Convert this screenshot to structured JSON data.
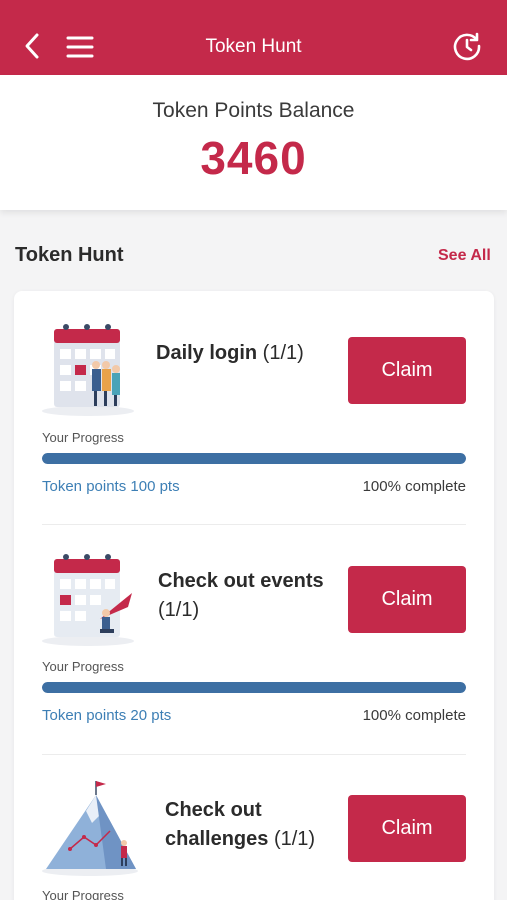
{
  "header": {
    "title": "Token Hunt",
    "back_icon": "chevron-left-icon",
    "menu_icon": "hamburger-menu-icon",
    "history_icon": "history-icon"
  },
  "balance": {
    "label": "Token Points Balance",
    "value": "3460"
  },
  "section": {
    "title": "Token Hunt",
    "see_all": "See All"
  },
  "tasks": [
    {
      "name": "Daily login",
      "count": " (1/1)",
      "claim_label": "Claim",
      "progress_label": "Your Progress",
      "progress": 1.0,
      "points": "Token points 100 pts",
      "percent": "100% complete"
    },
    {
      "name": "Check out events",
      "count": "(1/1)",
      "claim_label": "Claim",
      "progress_label": "Your Progress",
      "progress": 1.0,
      "points": "Token points 20 pts",
      "percent": "100% complete"
    },
    {
      "name_line1": "Check out",
      "name_line2": "challenges",
      "count": " (1/1)",
      "claim_label": "Claim",
      "progress_label": "Your Progress"
    }
  ],
  "colors": {
    "brand": "#c4294a",
    "progress": "#3d6fa3",
    "points_text": "#3d7fb5"
  }
}
